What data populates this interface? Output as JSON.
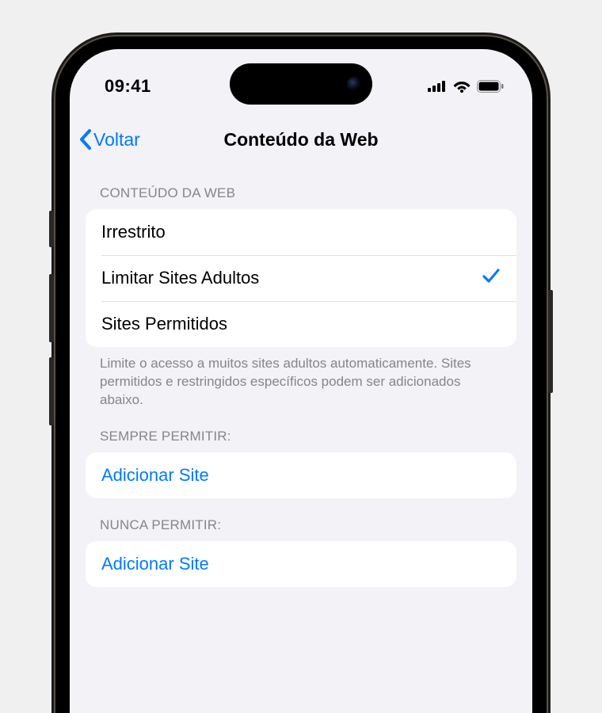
{
  "status": {
    "time": "09:41"
  },
  "nav": {
    "back_label": "Voltar",
    "title": "Conteúdo da Web"
  },
  "section1": {
    "header": "CONTEÚDO DA WEB",
    "options": {
      "unrestricted": "Irrestrito",
      "limit_adult": "Limitar Sites Adultos",
      "allowed_only": "Sites Permitidos"
    },
    "selected": "limit_adult",
    "footer": "Limite o acesso a muitos sites adultos automaticamente. Sites permitidos e restringidos específicos podem ser adicionados abaixo."
  },
  "section_allow": {
    "header": "SEMPRE PERMITIR:",
    "add_label": "Adicionar Site"
  },
  "section_never": {
    "header": "NUNCA PERMITIR:",
    "add_label": "Adicionar Site"
  }
}
